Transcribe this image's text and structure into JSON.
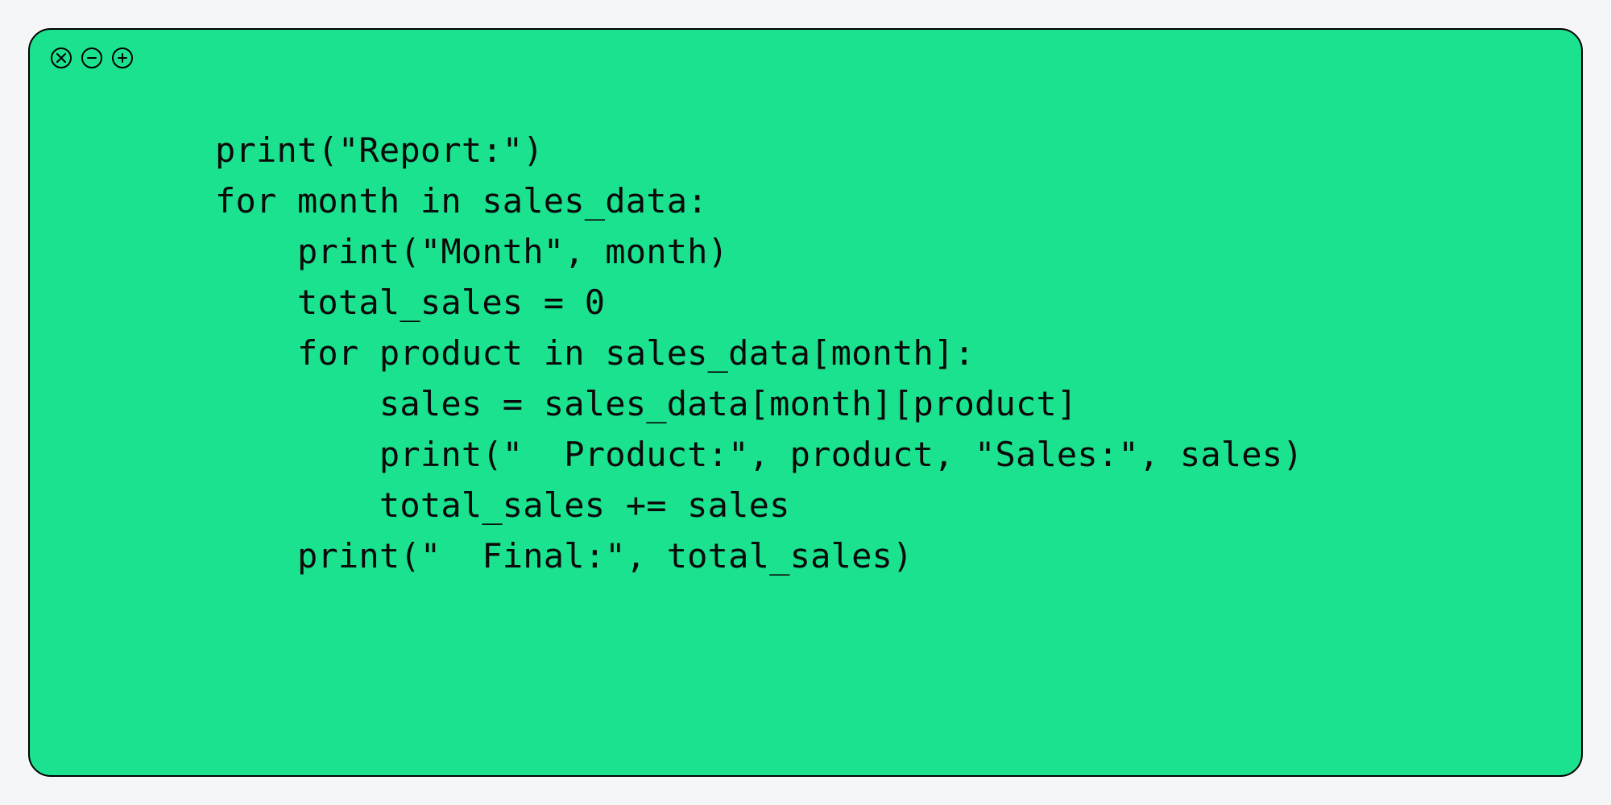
{
  "window": {
    "background": "#1be28f",
    "border_color": "#000000"
  },
  "buttons": {
    "close": "close",
    "minimize": "minimize",
    "maximize": "maximize"
  },
  "code": {
    "lines": [
      "print(\"Report:\")",
      "for month in sales_data:",
      "    print(\"Month\", month)",
      "    total_sales = 0",
      "    for product in sales_data[month]:",
      "        sales = sales_data[month][product]",
      "        print(\"  Product:\", product, \"Sales:\", sales)",
      "        total_sales += sales",
      "    print(\"  Final:\", total_sales)"
    ]
  }
}
